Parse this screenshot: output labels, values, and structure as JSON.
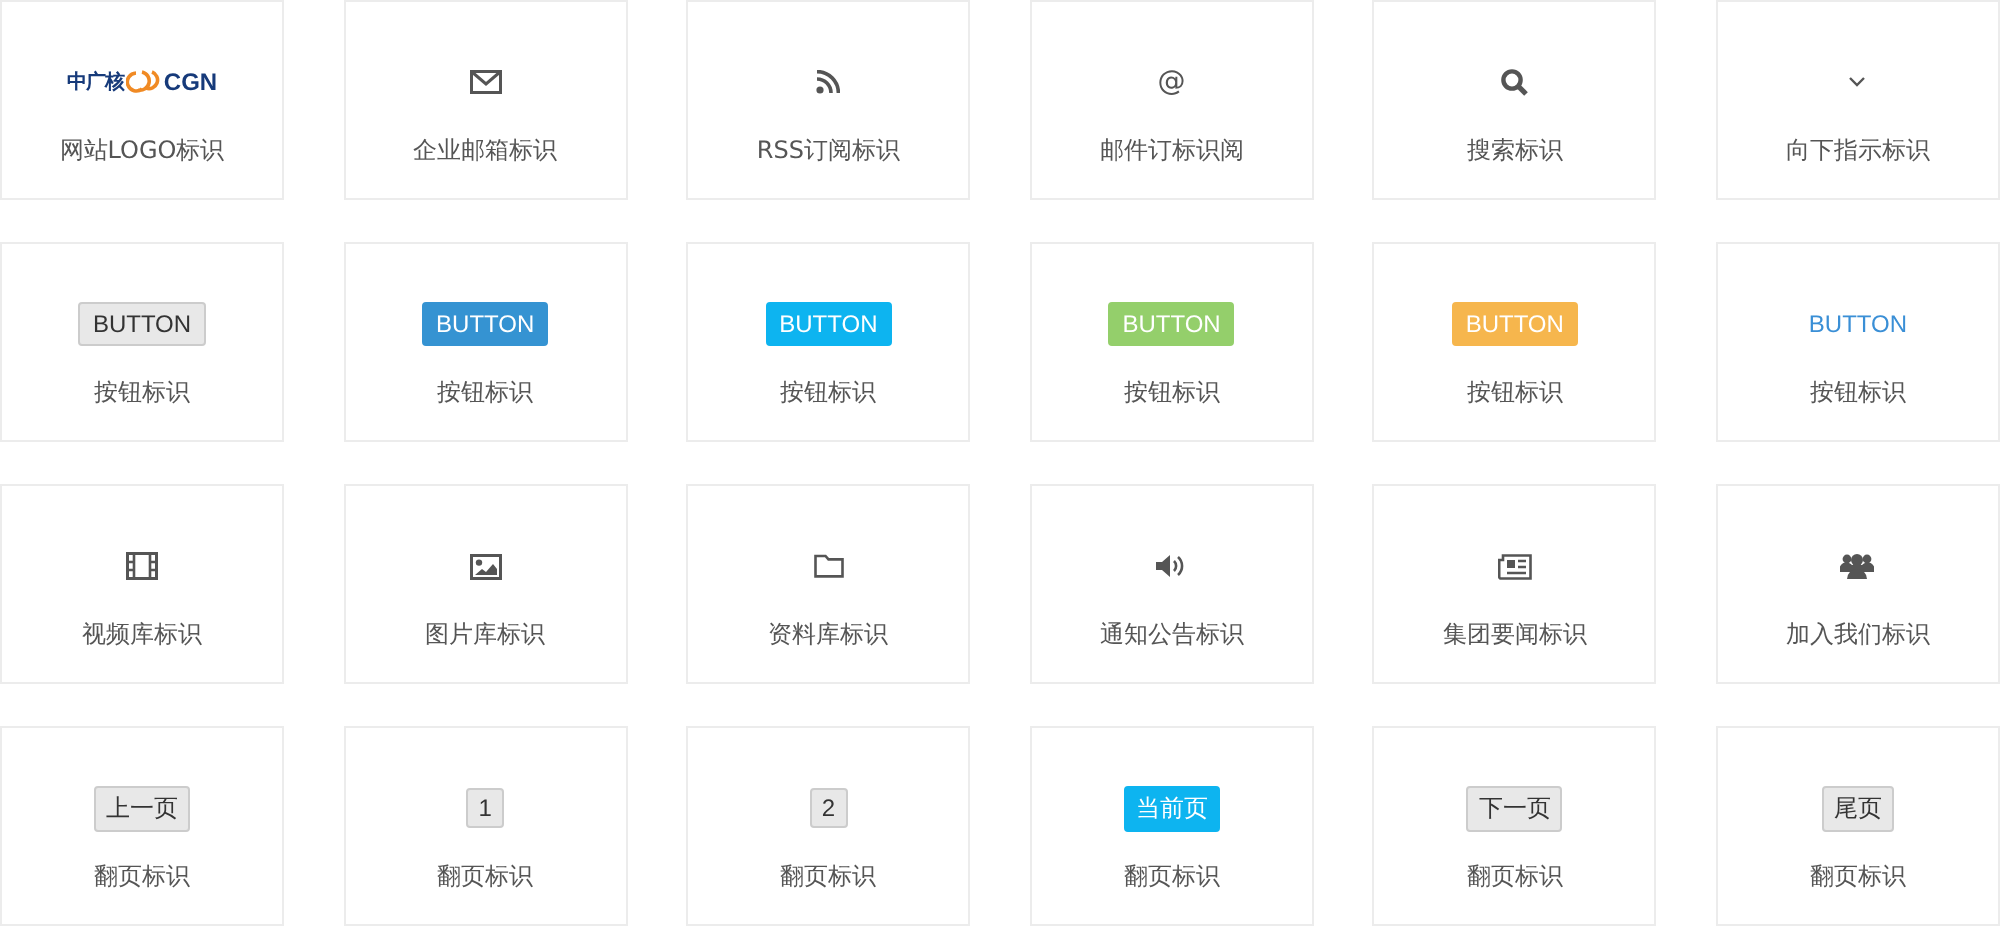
{
  "cards": [
    {
      "kind": "logo",
      "logo": {
        "cn": "中广核",
        "en": "CGN"
      },
      "label": "网站LOGO标识"
    },
    {
      "kind": "mail",
      "label": "企业邮箱标识"
    },
    {
      "kind": "rss",
      "label": "RSS订阅标识"
    },
    {
      "kind": "glyph",
      "glyph": "@",
      "label": "邮件订标识阅"
    },
    {
      "kind": "search",
      "label": "搜索标识"
    },
    {
      "kind": "chevron",
      "label": "向下指示标识"
    },
    {
      "kind": "greybutton",
      "text": "BUTTON",
      "label": "按钮标识"
    },
    {
      "kind": "button",
      "color": "#3593d2",
      "text": "BUTTON",
      "label": "按钮标识"
    },
    {
      "kind": "button",
      "color": "#0db4f0",
      "text": "BUTTON",
      "label": "按钮标识"
    },
    {
      "kind": "button",
      "color": "#94cf6b",
      "text": "BUTTON",
      "label": "按钮标识"
    },
    {
      "kind": "button",
      "color": "#f6b64d",
      "text": "BUTTON",
      "label": "按钮标识"
    },
    {
      "kind": "linkbutton",
      "text": "BUTTON",
      "label": "按钮标识"
    },
    {
      "kind": "film",
      "label": "视频库标识"
    },
    {
      "kind": "image",
      "label": "图片库标识"
    },
    {
      "kind": "folder",
      "label": "资料库标识"
    },
    {
      "kind": "speaker",
      "label": "通知公告标识"
    },
    {
      "kind": "newspaper",
      "label": "集团要闻标识"
    },
    {
      "kind": "users",
      "label": "加入我们标识"
    },
    {
      "kind": "page",
      "text": "上一页",
      "selected": false,
      "label": "翻页标识"
    },
    {
      "kind": "page",
      "text": "1",
      "selected": false,
      "label": "翻页标识"
    },
    {
      "kind": "page",
      "text": "2",
      "selected": false,
      "label": "翻页标识"
    },
    {
      "kind": "page",
      "text": "当前页",
      "selected": true,
      "label": "翻页标识"
    },
    {
      "kind": "page",
      "text": "下一页",
      "selected": false,
      "label": "翻页标识"
    },
    {
      "kind": "page",
      "text": "尾页",
      "selected": false,
      "label": "翻页标识"
    }
  ]
}
